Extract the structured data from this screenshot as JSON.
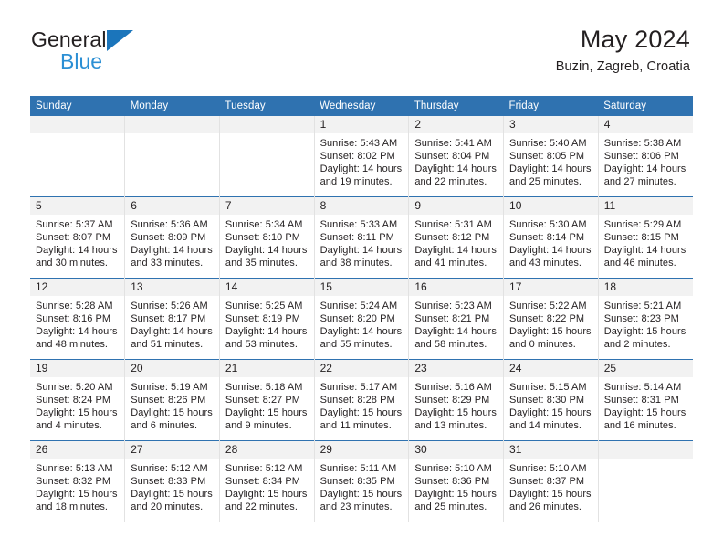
{
  "brand": {
    "line1": "General",
    "line2": "Blue",
    "logo_icon": "triangle-icon",
    "accent_dark": "#1b75bb",
    "accent_light": "#2b8fd4"
  },
  "header": {
    "title": "May 2024",
    "subtitle": "Buzin, Zagreb, Croatia"
  },
  "theme": {
    "header_blue": "#2f72b0",
    "daynum_band": "#f2f2f2",
    "text": "#231f20",
    "cell_divider": "#e2e2e2"
  },
  "calendar": {
    "weekday_headers": [
      "Sunday",
      "Monday",
      "Tuesday",
      "Wednesday",
      "Thursday",
      "Friday",
      "Saturday"
    ],
    "labels": {
      "sunrise_prefix": "Sunrise:",
      "sunset_prefix": "Sunset:",
      "daylight_prefix": "Daylight:"
    },
    "weeks": [
      [
        {
          "day": "",
          "blank": true
        },
        {
          "day": "",
          "blank": true
        },
        {
          "day": "",
          "blank": true
        },
        {
          "day": "1",
          "sunrise": "Sunrise: 5:43 AM",
          "sunset": "Sunset: 8:02 PM",
          "daylight_l1": "Daylight: 14 hours",
          "daylight_l2": "and 19 minutes."
        },
        {
          "day": "2",
          "sunrise": "Sunrise: 5:41 AM",
          "sunset": "Sunset: 8:04 PM",
          "daylight_l1": "Daylight: 14 hours",
          "daylight_l2": "and 22 minutes."
        },
        {
          "day": "3",
          "sunrise": "Sunrise: 5:40 AM",
          "sunset": "Sunset: 8:05 PM",
          "daylight_l1": "Daylight: 14 hours",
          "daylight_l2": "and 25 minutes."
        },
        {
          "day": "4",
          "sunrise": "Sunrise: 5:38 AM",
          "sunset": "Sunset: 8:06 PM",
          "daylight_l1": "Daylight: 14 hours",
          "daylight_l2": "and 27 minutes."
        }
      ],
      [
        {
          "day": "5",
          "sunrise": "Sunrise: 5:37 AM",
          "sunset": "Sunset: 8:07 PM",
          "daylight_l1": "Daylight: 14 hours",
          "daylight_l2": "and 30 minutes."
        },
        {
          "day": "6",
          "sunrise": "Sunrise: 5:36 AM",
          "sunset": "Sunset: 8:09 PM",
          "daylight_l1": "Daylight: 14 hours",
          "daylight_l2": "and 33 minutes."
        },
        {
          "day": "7",
          "sunrise": "Sunrise: 5:34 AM",
          "sunset": "Sunset: 8:10 PM",
          "daylight_l1": "Daylight: 14 hours",
          "daylight_l2": "and 35 minutes."
        },
        {
          "day": "8",
          "sunrise": "Sunrise: 5:33 AM",
          "sunset": "Sunset: 8:11 PM",
          "daylight_l1": "Daylight: 14 hours",
          "daylight_l2": "and 38 minutes."
        },
        {
          "day": "9",
          "sunrise": "Sunrise: 5:31 AM",
          "sunset": "Sunset: 8:12 PM",
          "daylight_l1": "Daylight: 14 hours",
          "daylight_l2": "and 41 minutes."
        },
        {
          "day": "10",
          "sunrise": "Sunrise: 5:30 AM",
          "sunset": "Sunset: 8:14 PM",
          "daylight_l1": "Daylight: 14 hours",
          "daylight_l2": "and 43 minutes."
        },
        {
          "day": "11",
          "sunrise": "Sunrise: 5:29 AM",
          "sunset": "Sunset: 8:15 PM",
          "daylight_l1": "Daylight: 14 hours",
          "daylight_l2": "and 46 minutes."
        }
      ],
      [
        {
          "day": "12",
          "sunrise": "Sunrise: 5:28 AM",
          "sunset": "Sunset: 8:16 PM",
          "daylight_l1": "Daylight: 14 hours",
          "daylight_l2": "and 48 minutes."
        },
        {
          "day": "13",
          "sunrise": "Sunrise: 5:26 AM",
          "sunset": "Sunset: 8:17 PM",
          "daylight_l1": "Daylight: 14 hours",
          "daylight_l2": "and 51 minutes."
        },
        {
          "day": "14",
          "sunrise": "Sunrise: 5:25 AM",
          "sunset": "Sunset: 8:19 PM",
          "daylight_l1": "Daylight: 14 hours",
          "daylight_l2": "and 53 minutes."
        },
        {
          "day": "15",
          "sunrise": "Sunrise: 5:24 AM",
          "sunset": "Sunset: 8:20 PM",
          "daylight_l1": "Daylight: 14 hours",
          "daylight_l2": "and 55 minutes."
        },
        {
          "day": "16",
          "sunrise": "Sunrise: 5:23 AM",
          "sunset": "Sunset: 8:21 PM",
          "daylight_l1": "Daylight: 14 hours",
          "daylight_l2": "and 58 minutes."
        },
        {
          "day": "17",
          "sunrise": "Sunrise: 5:22 AM",
          "sunset": "Sunset: 8:22 PM",
          "daylight_l1": "Daylight: 15 hours",
          "daylight_l2": "and 0 minutes."
        },
        {
          "day": "18",
          "sunrise": "Sunrise: 5:21 AM",
          "sunset": "Sunset: 8:23 PM",
          "daylight_l1": "Daylight: 15 hours",
          "daylight_l2": "and 2 minutes."
        }
      ],
      [
        {
          "day": "19",
          "sunrise": "Sunrise: 5:20 AM",
          "sunset": "Sunset: 8:24 PM",
          "daylight_l1": "Daylight: 15 hours",
          "daylight_l2": "and 4 minutes."
        },
        {
          "day": "20",
          "sunrise": "Sunrise: 5:19 AM",
          "sunset": "Sunset: 8:26 PM",
          "daylight_l1": "Daylight: 15 hours",
          "daylight_l2": "and 6 minutes."
        },
        {
          "day": "21",
          "sunrise": "Sunrise: 5:18 AM",
          "sunset": "Sunset: 8:27 PM",
          "daylight_l1": "Daylight: 15 hours",
          "daylight_l2": "and 9 minutes."
        },
        {
          "day": "22",
          "sunrise": "Sunrise: 5:17 AM",
          "sunset": "Sunset: 8:28 PM",
          "daylight_l1": "Daylight: 15 hours",
          "daylight_l2": "and 11 minutes."
        },
        {
          "day": "23",
          "sunrise": "Sunrise: 5:16 AM",
          "sunset": "Sunset: 8:29 PM",
          "daylight_l1": "Daylight: 15 hours",
          "daylight_l2": "and 13 minutes."
        },
        {
          "day": "24",
          "sunrise": "Sunrise: 5:15 AM",
          "sunset": "Sunset: 8:30 PM",
          "daylight_l1": "Daylight: 15 hours",
          "daylight_l2": "and 14 minutes."
        },
        {
          "day": "25",
          "sunrise": "Sunrise: 5:14 AM",
          "sunset": "Sunset: 8:31 PM",
          "daylight_l1": "Daylight: 15 hours",
          "daylight_l2": "and 16 minutes."
        }
      ],
      [
        {
          "day": "26",
          "sunrise": "Sunrise: 5:13 AM",
          "sunset": "Sunset: 8:32 PM",
          "daylight_l1": "Daylight: 15 hours",
          "daylight_l2": "and 18 minutes."
        },
        {
          "day": "27",
          "sunrise": "Sunrise: 5:12 AM",
          "sunset": "Sunset: 8:33 PM",
          "daylight_l1": "Daylight: 15 hours",
          "daylight_l2": "and 20 minutes."
        },
        {
          "day": "28",
          "sunrise": "Sunrise: 5:12 AM",
          "sunset": "Sunset: 8:34 PM",
          "daylight_l1": "Daylight: 15 hours",
          "daylight_l2": "and 22 minutes."
        },
        {
          "day": "29",
          "sunrise": "Sunrise: 5:11 AM",
          "sunset": "Sunset: 8:35 PM",
          "daylight_l1": "Daylight: 15 hours",
          "daylight_l2": "and 23 minutes."
        },
        {
          "day": "30",
          "sunrise": "Sunrise: 5:10 AM",
          "sunset": "Sunset: 8:36 PM",
          "daylight_l1": "Daylight: 15 hours",
          "daylight_l2": "and 25 minutes."
        },
        {
          "day": "31",
          "sunrise": "Sunrise: 5:10 AM",
          "sunset": "Sunset: 8:37 PM",
          "daylight_l1": "Daylight: 15 hours",
          "daylight_l2": "and 26 minutes."
        },
        {
          "day": "",
          "blank": true
        }
      ]
    ]
  }
}
